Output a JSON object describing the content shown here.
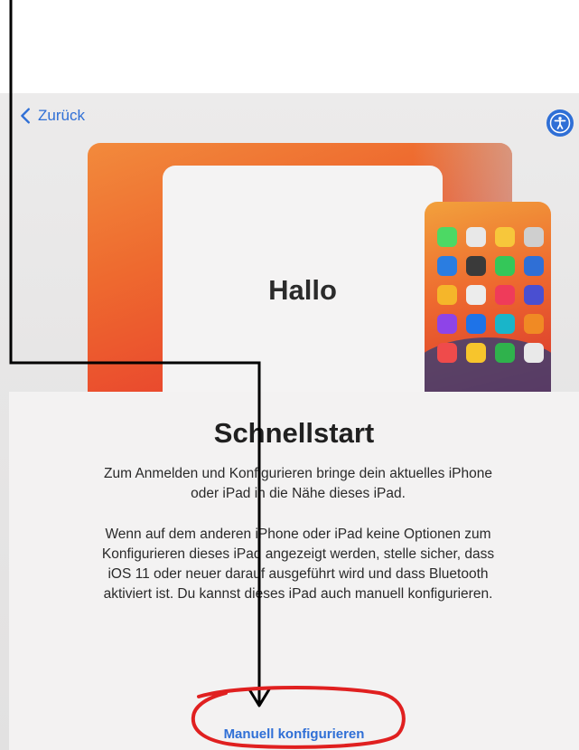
{
  "nav": {
    "back_label": "Zurück"
  },
  "hero": {
    "greeting": "Hallo",
    "app_icon_colors": [
      "#4cd964",
      "#e8e8e8",
      "#f7c73b",
      "#cfcfcf",
      "#2a7de1",
      "#3a3a3a",
      "#34c759",
      "#2f6fd6",
      "#f5b62a",
      "#ececec",
      "#ef3b5a",
      "#4a4fd1",
      "#8e44e8",
      "#1e73e8",
      "#19b5c9",
      "#f08a24",
      "#ef4b4b",
      "#f7c52c",
      "#2fb24c",
      "#e9e9e9"
    ]
  },
  "main": {
    "title": "Schnellstart",
    "paragraph1": "Zum Anmelden und Konfigurieren bringe dein aktuelles iPhone oder iPad in die Nähe dieses iPad.",
    "paragraph2": "Wenn auf dem anderen iPhone oder iPad keine Optionen zum Konfigurieren dieses iPad angezeigt werden, stelle sicher, dass iOS 11 oder neuer darauf ausgeführt wird und dass Bluetooth aktiviert ist. Du kannst dieses iPad auch manuell konfigurieren.",
    "manual_link": "Manuell konfigurieren"
  },
  "colors": {
    "accent": "#2f6fd6",
    "annotation_line": "#000000",
    "annotation_circle": "#e02020"
  },
  "icons": {
    "back": "chevron-left-icon",
    "accessibility": "accessibility-icon"
  }
}
